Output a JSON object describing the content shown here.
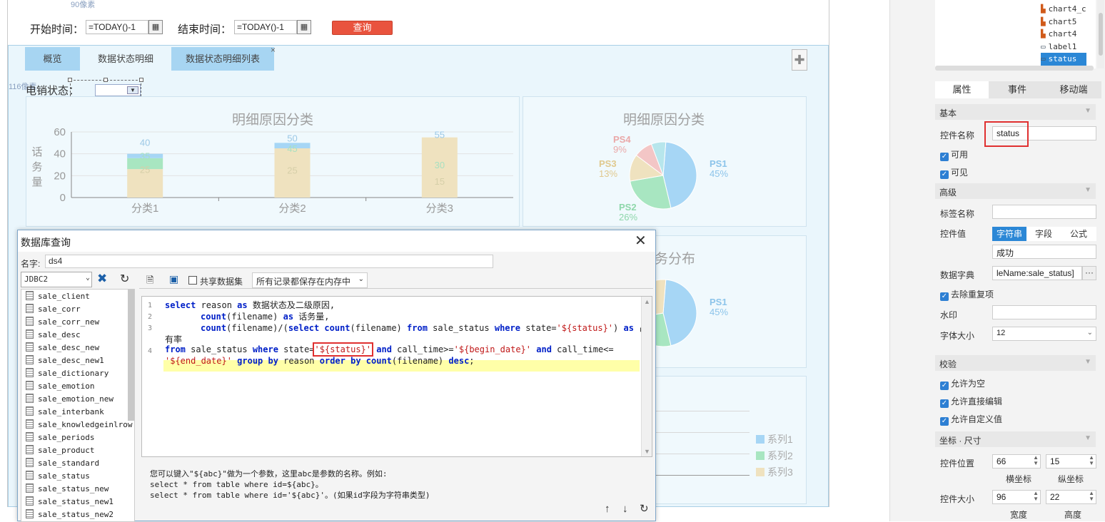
{
  "designer": {
    "top_hint": "90像素",
    "side_hint": "116像素",
    "start_label": "开始时间：",
    "start_value": "=TODAY()-1",
    "end_label": "结束时间：",
    "end_value": "=TODAY()-1",
    "query_button": "查询",
    "tabs": [
      "概览",
      "数据状态明细",
      "数据状态明细列表"
    ],
    "status_label": "电销状态："
  },
  "chart_data": [
    {
      "type": "bar",
      "title": "明细原因分类",
      "ylabel": "话务量",
      "categories": [
        "分类1",
        "分类2",
        "分类3"
      ],
      "ylim": [
        0,
        60
      ],
      "yticks": [
        0,
        20,
        40,
        60
      ],
      "series": [
        {
          "name": "系列1",
          "values": [
            4,
            5,
            0
          ],
          "color": "#a6d6f5"
        },
        {
          "name": "系列2",
          "values": [
            10,
            0,
            0
          ],
          "color": "#a8e6c1"
        },
        {
          "name": "系列3",
          "values": [
            26,
            45,
            55
          ],
          "color": "#efe2bf"
        }
      ],
      "data_labels": [
        [
          "40",
          "35",
          "25"
        ],
        [
          "50",
          "45",
          "25"
        ],
        [
          "55",
          "30",
          "15"
        ]
      ],
      "stacked": true
    },
    {
      "type": "pie",
      "title": "明细原因分类",
      "slices": [
        {
          "label": "PS1",
          "pct": "45%",
          "value": 45,
          "color": "#a6d6f5"
        },
        {
          "label": "PS2",
          "pct": "26%",
          "value": 26,
          "color": "#a8e6c1"
        },
        {
          "label": "PS3",
          "pct": "13%",
          "value": 13,
          "color": "#efe2bf"
        },
        {
          "label": "PS4",
          "pct": "9%",
          "value": 9,
          "color": "#f3c6c6"
        },
        {
          "label": "",
          "pct": "",
          "value": 7,
          "color": "#b7e6ec"
        }
      ]
    },
    {
      "type": "pie",
      "title": "务分布",
      "slices": [
        {
          "label": "PS1",
          "pct": "45%",
          "value": 45,
          "color": "#a6d6f5"
        },
        {
          "label": "",
          "pct": "",
          "value": 26,
          "color": "#a8e6c1"
        },
        {
          "label": "",
          "pct": "",
          "value": 29,
          "color": "#efe2bf"
        }
      ]
    },
    {
      "type": "line",
      "legend": [
        "系列1",
        "系列2",
        "系列3"
      ],
      "legend_colors": [
        "#a6d6f5",
        "#a8e6c1",
        "#efe2bf"
      ]
    }
  ],
  "props": {
    "tree_items": [
      "chart4_c",
      "chart5",
      "chart4",
      "label1",
      "status"
    ],
    "tabs": [
      "属性",
      "事件",
      "移动端"
    ],
    "sec_basic": "基本",
    "ctrl_name_label": "控件名称",
    "ctrl_name_value": "status",
    "enabled": "可用",
    "visible": "可见",
    "sec_advanced": "高级",
    "tag_name_label": "标签名称",
    "ctrl_value_label": "控件值",
    "value_types": [
      "字符串",
      "字段",
      "公式"
    ],
    "ctrl_value": "成功",
    "dict_label": "数据字典",
    "dict_value": "leName:sale_status]",
    "dedupe": "去除重复项",
    "watermark_label": "水印",
    "font_size_label": "字体大小",
    "font_size_value": "12",
    "sec_validate": "校验",
    "allow_empty": "允许为空",
    "allow_direct_edit": "允许直接编辑",
    "allow_custom": "允许自定义值",
    "sec_pos": "坐标 · 尺寸",
    "pos_label": "控件位置",
    "pos_x": "66",
    "pos_y": "15",
    "pos_x_label": "横坐标",
    "pos_y_label": "纵坐标",
    "size_label": "控件大小",
    "size_w": "96",
    "size_h": "22",
    "size_w_label": "宽度",
    "size_h_label": "高度"
  },
  "dialog": {
    "title": "数据库查询",
    "name_label": "名字:",
    "name_value": "ds4",
    "connection": "JDBC2",
    "share_label": "共享数据集",
    "storage_option": "所有记录都保存在内存中",
    "tables": [
      "sale_client",
      "sale_corr",
      "sale_corr_new",
      "sale_desc",
      "sale_desc_new",
      "sale_desc_new1",
      "sale_dictionary",
      "sale_emotion",
      "sale_emotion_new",
      "sale_interbank",
      "sale_knowledgeinlrow",
      "sale_periods",
      "sale_product",
      "sale_standard",
      "sale_status",
      "sale_status_new",
      "sale_status_new1",
      "sale_status_new2"
    ],
    "line_numbers": [
      "1",
      "2",
      "3",
      "4"
    ],
    "sql": {
      "l1a": "select",
      "l1b": " reason ",
      "l1c": "as",
      "l1d": " 数据状态及二级原因,",
      "l2a": "count",
      "l2b": "(filename) ",
      "l2c": "as",
      "l2d": " 话务量,",
      "l3a": "count",
      "l3b": "(filename)/(",
      "l3c": "select count",
      "l3d": "(filename) ",
      "l3e": "from",
      "l3f": " sale_status ",
      "l3g": "where",
      "l3h": " state=",
      "l3i": "'${status}'",
      "l3j": ") ",
      "l3k": "as",
      "l3l": " 占",
      "l3m": "有率",
      "l4a": "from",
      "l4b": " sale_status ",
      "l4c": "where",
      "l4d": " state=",
      "l4e": "'${status}'",
      "l4f": "and",
      "l4g": " call_time>=",
      "l4h": "'${begin_date}'",
      "l4i": "and",
      "l4j": " call_time<=",
      "l5a": "'${end_date}'",
      "l5b": "group by",
      "l5c": " reason ",
      "l5d": "order by count",
      "l5e": "(filename) ",
      "l5f": "desc",
      "l5g": ";"
    },
    "hint1": "您可以键入\"${abc}\"做为一个参数，这里abc是参数的名称。例如:",
    "hint2": "select * from table where id=${abc}。",
    "hint3": "select * from table where id='${abc}'。(如果id字段为字符串类型)"
  }
}
